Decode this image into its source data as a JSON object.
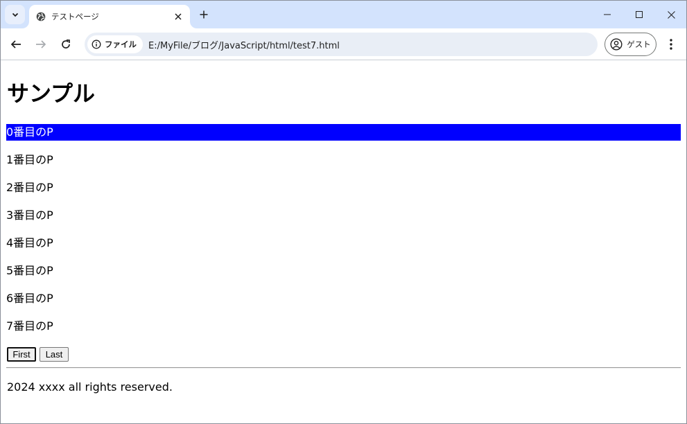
{
  "browser": {
    "tab_title": "テストページ",
    "site_chip_label": "ファイル",
    "url": "E:/MyFile/ブログ/JavaScript/html/test7.html",
    "profile_label": "ゲスト"
  },
  "page": {
    "title": "サンプル",
    "paragraphs": [
      "0番目のP",
      "1番目のP",
      "2番目のP",
      "3番目のP",
      "4番目のP",
      "5番目のP",
      "6番目のP",
      "7番目のP"
    ],
    "highlighted_index": 0,
    "highlight_color": "#0000ff",
    "buttons": {
      "first": "First",
      "last": "Last"
    },
    "footer": "2024 xxxx all rights reserved."
  }
}
